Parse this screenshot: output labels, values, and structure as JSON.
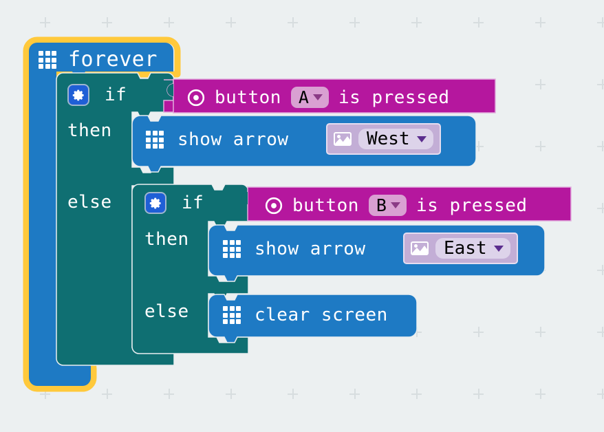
{
  "workspace": {
    "background_color": "#ecf0f1",
    "grid_mark": "plus",
    "grid_spacing": 90
  },
  "palette": {
    "loop_blue": "#1e7ac4",
    "loop_highlight": "#ffc93c",
    "logic_teal": "#0f6f72",
    "input_magenta": "#b5179e",
    "basic_blue": "#1e7ac4",
    "reporter_purple": "#c3aed6",
    "dropdown_pink": "#d9a0d2"
  },
  "program": {
    "forever": {
      "label": "forever",
      "icon": "led-matrix-icon",
      "selected": true
    },
    "outer_if": {
      "gear_icon": "gear-icon",
      "if_label": "if",
      "then_label": "then",
      "else_label": "else",
      "condition": {
        "icon": "target-icon",
        "prefix": "button",
        "dropdown_value": "A",
        "suffix": "is pressed",
        "caret": "chevron-down-icon"
      },
      "then_statement": {
        "icon": "led-matrix-icon",
        "label": "show arrow",
        "argument": {
          "icon": "image-icon",
          "dropdown_value": "West",
          "caret": "chevron-down-icon"
        }
      }
    },
    "inner_if": {
      "gear_icon": "gear-icon",
      "if_label": "if",
      "then_label": "then",
      "else_label": "else",
      "condition": {
        "icon": "target-icon",
        "prefix": "button",
        "dropdown_value": "B",
        "suffix": "is pressed",
        "caret": "chevron-down-icon"
      },
      "then_statement": {
        "icon": "led-matrix-icon",
        "label": "show arrow",
        "argument": {
          "icon": "image-icon",
          "dropdown_value": "East",
          "caret": "chevron-down-icon"
        }
      },
      "else_statement": {
        "icon": "led-matrix-icon",
        "label": "clear screen"
      }
    }
  }
}
